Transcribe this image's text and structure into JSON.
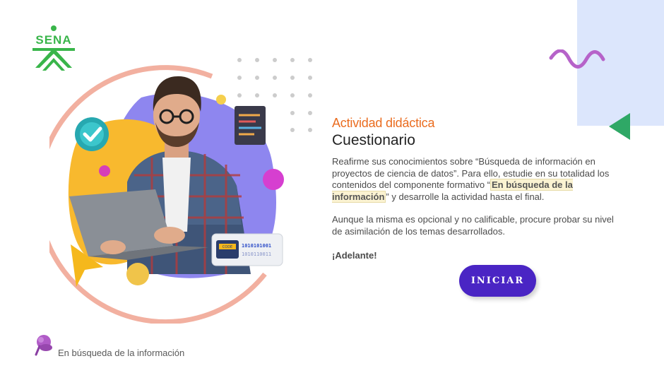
{
  "brand": {
    "logo_text": "SENA"
  },
  "activity": {
    "kicker": "Actividad didáctica",
    "title": "Cuestionario",
    "intro_part1": "Reafirme sus conocimientos sobre “Búsqueda de información en proyectos de ciencia de datos”.  Para ello, estudie en su totalidad los contenidos del componente formativo “",
    "component_name": "En búsqueda de la información",
    "intro_part2": "” y desarrolle la actividad hasta el final.",
    "note": "Aunque la misma es opcional y no calificable, procure probar su nivel de asimilación de los temas desarrollados.",
    "cheer": "¡Adelante!",
    "start_label": "INICIAR"
  },
  "illustration": {
    "code_badge": "CODE",
    "binary_line1": "1010101001",
    "binary_line2": "1010110011"
  },
  "footer": {
    "component_label": "En búsqueda de la información"
  },
  "colors": {
    "accent_orange": "#ea6c1f",
    "button_purple": "#4a25c4",
    "brand_green": "#39b54a",
    "panel_blue": "#dce6fc"
  }
}
